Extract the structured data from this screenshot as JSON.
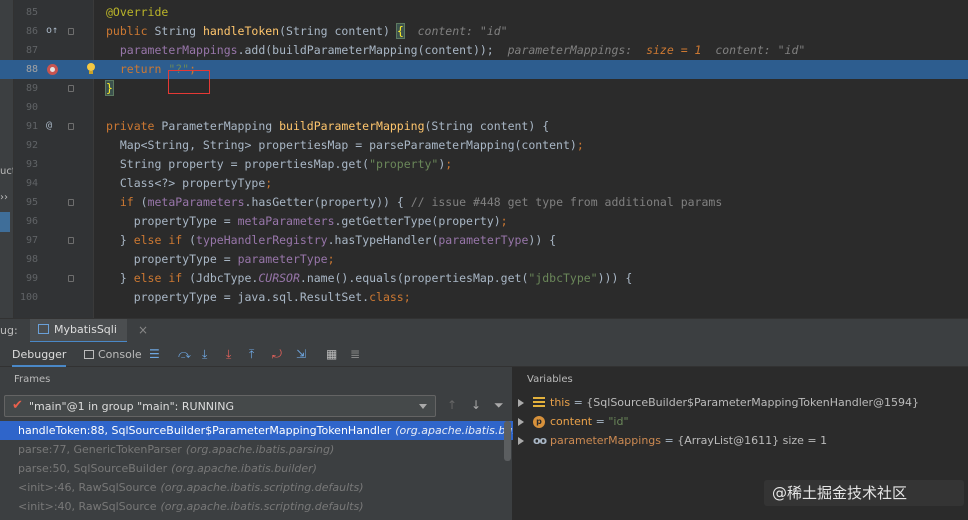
{
  "editor": {
    "left_fragments": [
      "uctu",
      "››"
    ],
    "lines": [
      {
        "num": "85",
        "segs": [
          {
            "t": "@Override",
            "c": "ann"
          }
        ]
      },
      {
        "num": "86",
        "gutter": "o↑",
        "fold": true,
        "segs": [
          {
            "t": "public ",
            "c": "kw"
          },
          {
            "t": "String ",
            "c": ""
          },
          {
            "t": "handleToken",
            "c": "fn"
          },
          {
            "t": "(String content) ",
            "c": ""
          },
          {
            "t": "{",
            "c": "brace-hl"
          },
          {
            "t": "  content: \"id\"",
            "c": "hint"
          }
        ]
      },
      {
        "num": "87",
        "segs": [
          {
            "t": "  ",
            "c": ""
          },
          {
            "t": "parameterMappings",
            "c": "fld"
          },
          {
            "t": ".add(buildParameterMapping(content));",
            "c": ""
          },
          {
            "t": "  parameterMappings:  ",
            "c": "hint"
          },
          {
            "t": "size = 1",
            "c": "hint-v"
          },
          {
            "t": "  content: \"id\"",
            "c": "hint"
          }
        ]
      },
      {
        "num": "88",
        "highlight": true,
        "breakpoint": true,
        "bulb": true,
        "segs": [
          {
            "t": "  ",
            "c": ""
          },
          {
            "t": "return ",
            "c": "kw"
          },
          {
            "t": "\"?\"",
            "c": "str"
          },
          {
            "t": ";",
            "c": "kw"
          }
        ]
      },
      {
        "num": "89",
        "fold": true,
        "segs": [
          {
            "t": "}",
            "c": "brace-hl"
          }
        ]
      },
      {
        "num": "90",
        "segs": []
      },
      {
        "num": "91",
        "gutter": "@",
        "fold": true,
        "segs": [
          {
            "t": "private ",
            "c": "kw"
          },
          {
            "t": "ParameterMapping ",
            "c": ""
          },
          {
            "t": "buildParameterMapping",
            "c": "fn"
          },
          {
            "t": "(String content) {",
            "c": ""
          }
        ]
      },
      {
        "num": "92",
        "segs": [
          {
            "t": "  Map<String, String> propertiesMap = parseParameterMapping(content)",
            "c": ""
          },
          {
            "t": ";",
            "c": "kw"
          }
        ]
      },
      {
        "num": "93",
        "segs": [
          {
            "t": "  String property = propertiesMap.get(",
            "c": ""
          },
          {
            "t": "\"property\"",
            "c": "str"
          },
          {
            "t": ")",
            "c": ""
          },
          {
            "t": ";",
            "c": "kw"
          }
        ]
      },
      {
        "num": "94",
        "segs": [
          {
            "t": "  Class<?> propertyType",
            "c": ""
          },
          {
            "t": ";",
            "c": "kw"
          }
        ]
      },
      {
        "num": "95",
        "fold": true,
        "segs": [
          {
            "t": "  ",
            "c": ""
          },
          {
            "t": "if ",
            "c": "kw"
          },
          {
            "t": "(",
            "c": ""
          },
          {
            "t": "metaParameters",
            "c": "fld"
          },
          {
            "t": ".hasGetter(property)) { ",
            "c": ""
          },
          {
            "t": "// issue #448 get type from additional params",
            "c": "cm"
          }
        ]
      },
      {
        "num": "96",
        "segs": [
          {
            "t": "    propertyType = ",
            "c": ""
          },
          {
            "t": "metaParameters",
            "c": "fld"
          },
          {
            "t": ".getGetterType(property)",
            "c": ""
          },
          {
            "t": ";",
            "c": "kw"
          }
        ]
      },
      {
        "num": "97",
        "fold": true,
        "segs": [
          {
            "t": "  } ",
            "c": ""
          },
          {
            "t": "else if ",
            "c": "kw"
          },
          {
            "t": "(",
            "c": ""
          },
          {
            "t": "typeHandlerRegistry",
            "c": "fld"
          },
          {
            "t": ".hasTypeHandler(",
            "c": ""
          },
          {
            "t": "parameterType",
            "c": "fld"
          },
          {
            "t": ")) {",
            "c": ""
          }
        ]
      },
      {
        "num": "98",
        "segs": [
          {
            "t": "    propertyType = ",
            "c": ""
          },
          {
            "t": "parameterType",
            "c": "fld"
          },
          {
            "t": ";",
            "c": "kw"
          }
        ]
      },
      {
        "num": "99",
        "fold": true,
        "segs": [
          {
            "t": "  } ",
            "c": ""
          },
          {
            "t": "else if ",
            "c": "kw"
          },
          {
            "t": "(JdbcType.",
            "c": ""
          },
          {
            "t": "CURSOR",
            "c": "fld it"
          },
          {
            "t": ".name().equals(propertiesMap.get(",
            "c": ""
          },
          {
            "t": "\"jdbcType\"",
            "c": "str"
          },
          {
            "t": "))) {",
            "c": ""
          }
        ]
      },
      {
        "num": "100",
        "segs": [
          {
            "t": "    propertyType = java.sql.ResultSet.",
            "c": ""
          },
          {
            "t": "class",
            "c": "kw"
          },
          {
            "t": ";",
            "c": "kw"
          }
        ]
      }
    ]
  },
  "debug": {
    "label": "ug:",
    "config_name": "MybatisSqli",
    "tabs": {
      "debugger": "Debugger",
      "console": "Console"
    }
  },
  "frames": {
    "title": "Frames",
    "thread": "\"main\"@1 in group \"main\": RUNNING",
    "items": [
      {
        "method": "handleToken:88, SqlSourceBuilder$ParameterMappingTokenHandler",
        "pkg": "(org.apache.ibatis.builder)",
        "selected": true
      },
      {
        "method": "parse:77, GenericTokenParser",
        "pkg": "(org.apache.ibatis.parsing)"
      },
      {
        "method": "parse:50, SqlSourceBuilder",
        "pkg": "(org.apache.ibatis.builder)"
      },
      {
        "method": "<init>:46, RawSqlSource",
        "pkg": "(org.apache.ibatis.scripting.defaults)"
      },
      {
        "method": "<init>:40, RawSqlSource",
        "pkg": "(org.apache.ibatis.scripting.defaults)"
      }
    ]
  },
  "variables": {
    "title": "Variables",
    "items": [
      {
        "icon": "this",
        "name": "this",
        "value": "{SqlSourceBuilder$ParameterMappingTokenHandler@1594}",
        "extra": ""
      },
      {
        "icon": "p",
        "name": "content",
        "value": "\"id\"",
        "extra": ""
      },
      {
        "icon": "oo",
        "name": "parameterMappings",
        "value": "{ArrayList@1611}",
        "extra": "  size = 1"
      }
    ]
  },
  "watermark": "@稀土掘金技术社区"
}
